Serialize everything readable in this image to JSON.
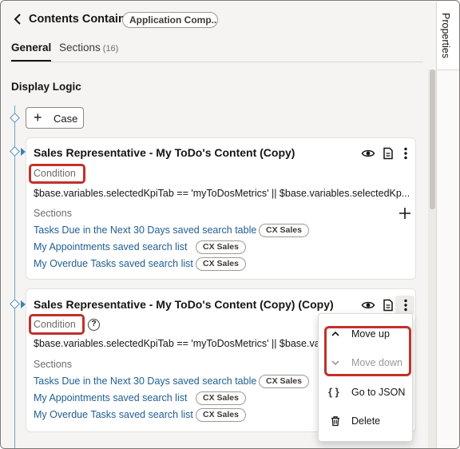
{
  "header": {
    "title": "Contents Container",
    "chip": "Application Comp..."
  },
  "tabs": [
    {
      "label": "General",
      "active": true
    },
    {
      "label": "Sections",
      "count": "(16)"
    }
  ],
  "section_title": "Display Logic",
  "case_button": "Case",
  "cards": [
    {
      "title": "Sales Representative - My ToDo's Content (Copy)",
      "condition_label": "Condition",
      "expression": "$base.variables.selectedKpiTab == 'myToDosMetrics' || $base.variables.selectedKp...",
      "sections_label": "Sections",
      "sections": [
        {
          "link": "Tasks Due in the Next 30 Days saved search table",
          "tag": "CX Sales"
        },
        {
          "link": "My Appointments saved search list",
          "tag": "CX Sales"
        },
        {
          "link": "My Overdue Tasks saved search list",
          "tag": "CX Sales"
        }
      ]
    },
    {
      "title": "Sales Representative - My ToDo's Content (Copy) (Copy)",
      "condition_label": "Condition",
      "help": "?",
      "expression": "$base.variables.selectedKpiTab == 'myToDosMetrics' || $base.varia",
      "sections_label": "Sections",
      "sections": [
        {
          "link": "Tasks Due in the Next 30 Days saved search table",
          "tag": "CX Sales"
        },
        {
          "link": "My Appointments saved search list",
          "tag": "CX Sales"
        },
        {
          "link": "My Overdue Tasks saved search list",
          "tag": "CX Sales"
        }
      ]
    }
  ],
  "menu": {
    "items": [
      {
        "label": "Move up",
        "icon": "chevron-up-icon",
        "disabled": false
      },
      {
        "label": "Move down",
        "icon": "chevron-down-icon",
        "disabled": true
      },
      {
        "label": "Go to JSON",
        "icon": "braces-icon",
        "disabled": false
      },
      {
        "label": "Delete",
        "icon": "trash-icon",
        "disabled": false
      }
    ]
  },
  "rail": {
    "label": "Properties"
  },
  "colors": {
    "accent_line": "#6fa6c8",
    "link": "#1f5e91",
    "highlight_box": "#c0322b"
  }
}
